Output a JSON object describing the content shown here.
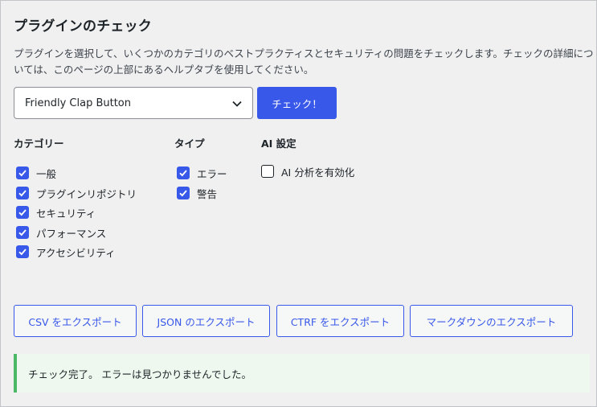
{
  "page": {
    "title": "プラグインのチェック",
    "description": "プラグインを選択して、いくつかのカテゴリのベストプラクティスとセキュリティの問題をチェックします。チェックの詳細については、このページの上部にあるヘルプタブを使用してください。"
  },
  "plugin_select": {
    "selected": "Friendly Clap Button"
  },
  "check_button": {
    "label": "チェック！"
  },
  "categories": {
    "heading": "カテゴリー",
    "items": [
      {
        "label": "一般",
        "checked": true
      },
      {
        "label": "プラグインリポジトリ",
        "checked": true
      },
      {
        "label": "セキュリティ",
        "checked": true
      },
      {
        "label": "パフォーマンス",
        "checked": true
      },
      {
        "label": "アクセシビリティ",
        "checked": true
      }
    ]
  },
  "types": {
    "heading": "タイプ",
    "items": [
      {
        "label": "エラー",
        "checked": true
      },
      {
        "label": "警告",
        "checked": true
      }
    ]
  },
  "ai": {
    "heading": "AI 設定",
    "items": [
      {
        "label": "AI 分析を有効化",
        "checked": false
      }
    ]
  },
  "exports": [
    {
      "label": "CSV をエクスポート"
    },
    {
      "label": "JSON のエクスポート"
    },
    {
      "label": "CTRF をエクスポート"
    },
    {
      "label": "マークダウンのエクスポート"
    }
  ],
  "notice": {
    "text": "チェック完了。 エラーは見つかりませんでした。"
  },
  "colors": {
    "accent": "#3858e9",
    "success": "#4ab866",
    "notice_bg": "#eef8ef",
    "background": "#f0f0f1"
  }
}
